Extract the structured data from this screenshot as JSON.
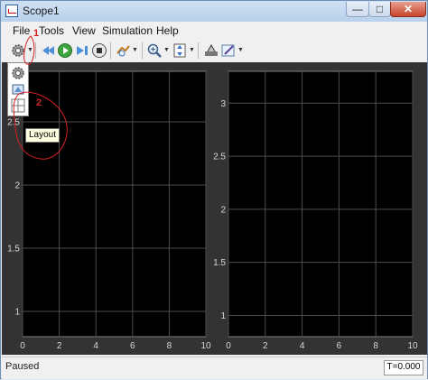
{
  "window": {
    "title": "Scope1",
    "min": "—",
    "max": "□",
    "close": "✕"
  },
  "menu": [
    "File",
    "Tools",
    "View",
    "Simulation",
    "Help"
  ],
  "toolbar": {
    "icons": [
      "gear-icon",
      "back-step-icon",
      "run-icon",
      "step-forward-icon",
      "stop-icon",
      "highlight-icon",
      "zoom-icon",
      "scale-axes-icon",
      "style-icon",
      "edit-icon"
    ]
  },
  "popup": {
    "items": [
      "config-properties-icon",
      "style-icon",
      "layout-icon"
    ]
  },
  "tooltip": {
    "text": "Layout"
  },
  "annotations": {
    "label1": "1",
    "label2": "2"
  },
  "status": {
    "left": "Paused",
    "time": "T=0.000"
  },
  "plots": [
    {
      "xticks": [
        "0",
        "2",
        "4",
        "6",
        "8",
        "10"
      ],
      "yticks": [
        "1",
        "1.5",
        "2",
        "2.5"
      ],
      "background": "#000000",
      "grid": "#4d4d4d"
    },
    {
      "xticks": [
        "0",
        "2",
        "4",
        "6",
        "8",
        "10"
      ],
      "yticks": [
        "1",
        "1.5",
        "2",
        "2.5",
        "3"
      ],
      "background": "#000000",
      "grid": "#4d4d4d"
    }
  ]
}
